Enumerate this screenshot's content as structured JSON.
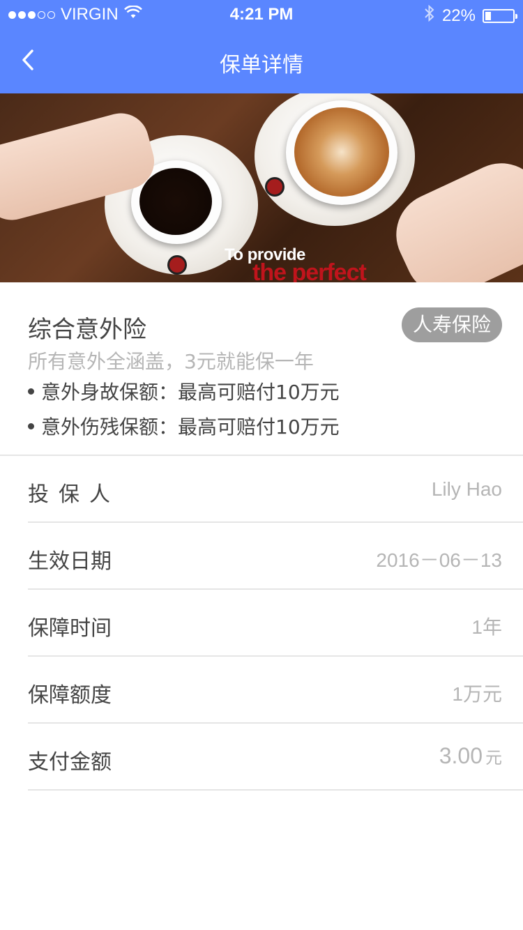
{
  "status_bar": {
    "carrier": "VIRGIN",
    "time": "4:21 PM",
    "battery_percent": "22%",
    "battery_level": 0.22,
    "signal_bars_filled": 3,
    "signal_bars_total": 5
  },
  "nav": {
    "title": "保单详情",
    "back_icon": "chevron-left-icon"
  },
  "banner": {
    "text_line1": "To provide",
    "text_line2": "the perfect"
  },
  "product": {
    "title": "综合意外险",
    "badge": "人寿保险",
    "subtitle": "所有意外全涵盖，3元就能保一年",
    "bullets": [
      "意外身故保额：最高可赔付10万元",
      "意外伤残保额：最高可赔付10万元"
    ]
  },
  "details": [
    {
      "label": "投保人",
      "value": "Lily Hao"
    },
    {
      "label": "生效日期",
      "value": "2016－06－13"
    },
    {
      "label": "保障时间",
      "value": "1年"
    },
    {
      "label": "保障额度",
      "value": "1万元"
    },
    {
      "label": "支付金额",
      "value": "3.00",
      "unit": "元"
    }
  ],
  "colors": {
    "header": "#5a86ff",
    "badge": "#9e9e9e",
    "muted_text": "#b5b5b5"
  }
}
